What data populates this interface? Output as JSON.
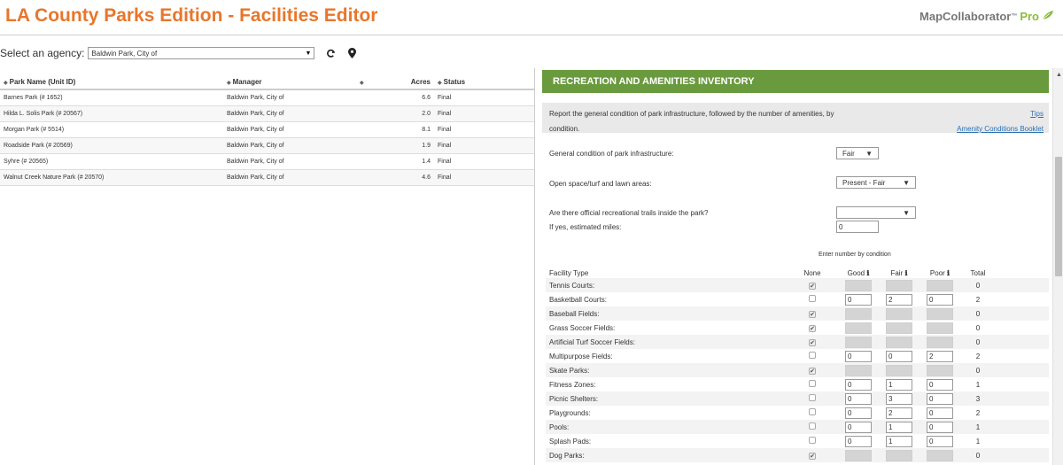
{
  "header": {
    "title": "LA County Parks Edition - Facilities Editor",
    "brand": "MapCollaborator",
    "brand_tm": "™",
    "brand_pro": "Pro"
  },
  "agency": {
    "label": "Select an agency:",
    "selected": "Baldwin Park, City of"
  },
  "parks_table": {
    "columns": [
      "Park Name (Unit ID)",
      "Manager",
      "",
      "Acres",
      "Status"
    ],
    "rows": [
      {
        "name": "Barnes Park (# 1652)",
        "manager": "Baldwin Park, City of",
        "acres": "6.6",
        "status": "Final"
      },
      {
        "name": "Hilda L. Solis Park (# 20567)",
        "manager": "Baldwin Park, City of",
        "acres": "2.0",
        "status": "Final"
      },
      {
        "name": "Morgan Park (# 5514)",
        "manager": "Baldwin Park, City of",
        "acres": "8.1",
        "status": "Final"
      },
      {
        "name": "Roadside Park (# 20569)",
        "manager": "Baldwin Park, City of",
        "acres": "1.9",
        "status": "Final"
      },
      {
        "name": "Syhre (# 20565)",
        "manager": "Baldwin Park, City of",
        "acres": "1.4",
        "status": "Final"
      },
      {
        "name": "Walnut Creek Nature Park (# 20570)",
        "manager": "Baldwin Park, City of",
        "acres": "4.6",
        "status": "Final"
      }
    ]
  },
  "inventory": {
    "banner": "RECREATION AND AMENITIES INVENTORY",
    "info_line1": "Report the general condition of park infrastructure, followed by the number of amenities, by",
    "info_line2": "condition.",
    "tips_link": "Tips",
    "booklet_link": "Amenity Conditions Booklet",
    "general_condition_label": "General condition of park infrastructure:",
    "general_condition_value": "Fair",
    "open_space_label": "Open space/turf and lawn areas:",
    "open_space_value": "Present - Fair",
    "trails_label": "Are there official recreational trails inside the park?",
    "trails_value": "",
    "miles_label": "If yes, estimated miles:",
    "miles_value": "0",
    "enter_number_label": "Enter number by condition",
    "col_facility": "Facility Type",
    "col_none": "None",
    "col_good": "Good",
    "col_fair": "Fair",
    "col_poor": "Poor",
    "col_total": "Total",
    "facilities": [
      {
        "name": "Tennis Courts:",
        "none": true,
        "good": "",
        "fair": "",
        "poor": "",
        "total": "0"
      },
      {
        "name": "Basketball Courts:",
        "none": false,
        "good": "0",
        "fair": "2",
        "poor": "0",
        "total": "2"
      },
      {
        "name": "Baseball Fields:",
        "none": true,
        "good": "",
        "fair": "",
        "poor": "",
        "total": "0"
      },
      {
        "name": "Grass Soccer Fields:",
        "none": true,
        "good": "",
        "fair": "",
        "poor": "",
        "total": "0"
      },
      {
        "name": "Artificial Turf Soccer Fields:",
        "none": true,
        "good": "",
        "fair": "",
        "poor": "",
        "total": "0"
      },
      {
        "name": "Multipurpose Fields:",
        "none": false,
        "good": "0",
        "fair": "0",
        "poor": "2",
        "total": "2"
      },
      {
        "name": "Skate Parks:",
        "none": true,
        "good": "",
        "fair": "",
        "poor": "",
        "total": "0"
      },
      {
        "name": "Fitness Zones:",
        "none": false,
        "good": "0",
        "fair": "1",
        "poor": "0",
        "total": "1"
      },
      {
        "name": "Picnic Shelters:",
        "none": false,
        "good": "0",
        "fair": "3",
        "poor": "0",
        "total": "3"
      },
      {
        "name": "Playgrounds:",
        "none": false,
        "good": "0",
        "fair": "2",
        "poor": "0",
        "total": "2"
      },
      {
        "name": "Pools:",
        "none": false,
        "good": "0",
        "fair": "1",
        "poor": "0",
        "total": "1"
      },
      {
        "name": "Splash Pads:",
        "none": false,
        "good": "0",
        "fair": "1",
        "poor": "0",
        "total": "1"
      },
      {
        "name": "Dog Parks:",
        "none": true,
        "good": "",
        "fair": "",
        "poor": "",
        "total": "0"
      }
    ]
  },
  "colors": {
    "title_orange": "#e8762b",
    "banner_green": "#6a9a3e",
    "link_blue": "#2b6fb5"
  }
}
